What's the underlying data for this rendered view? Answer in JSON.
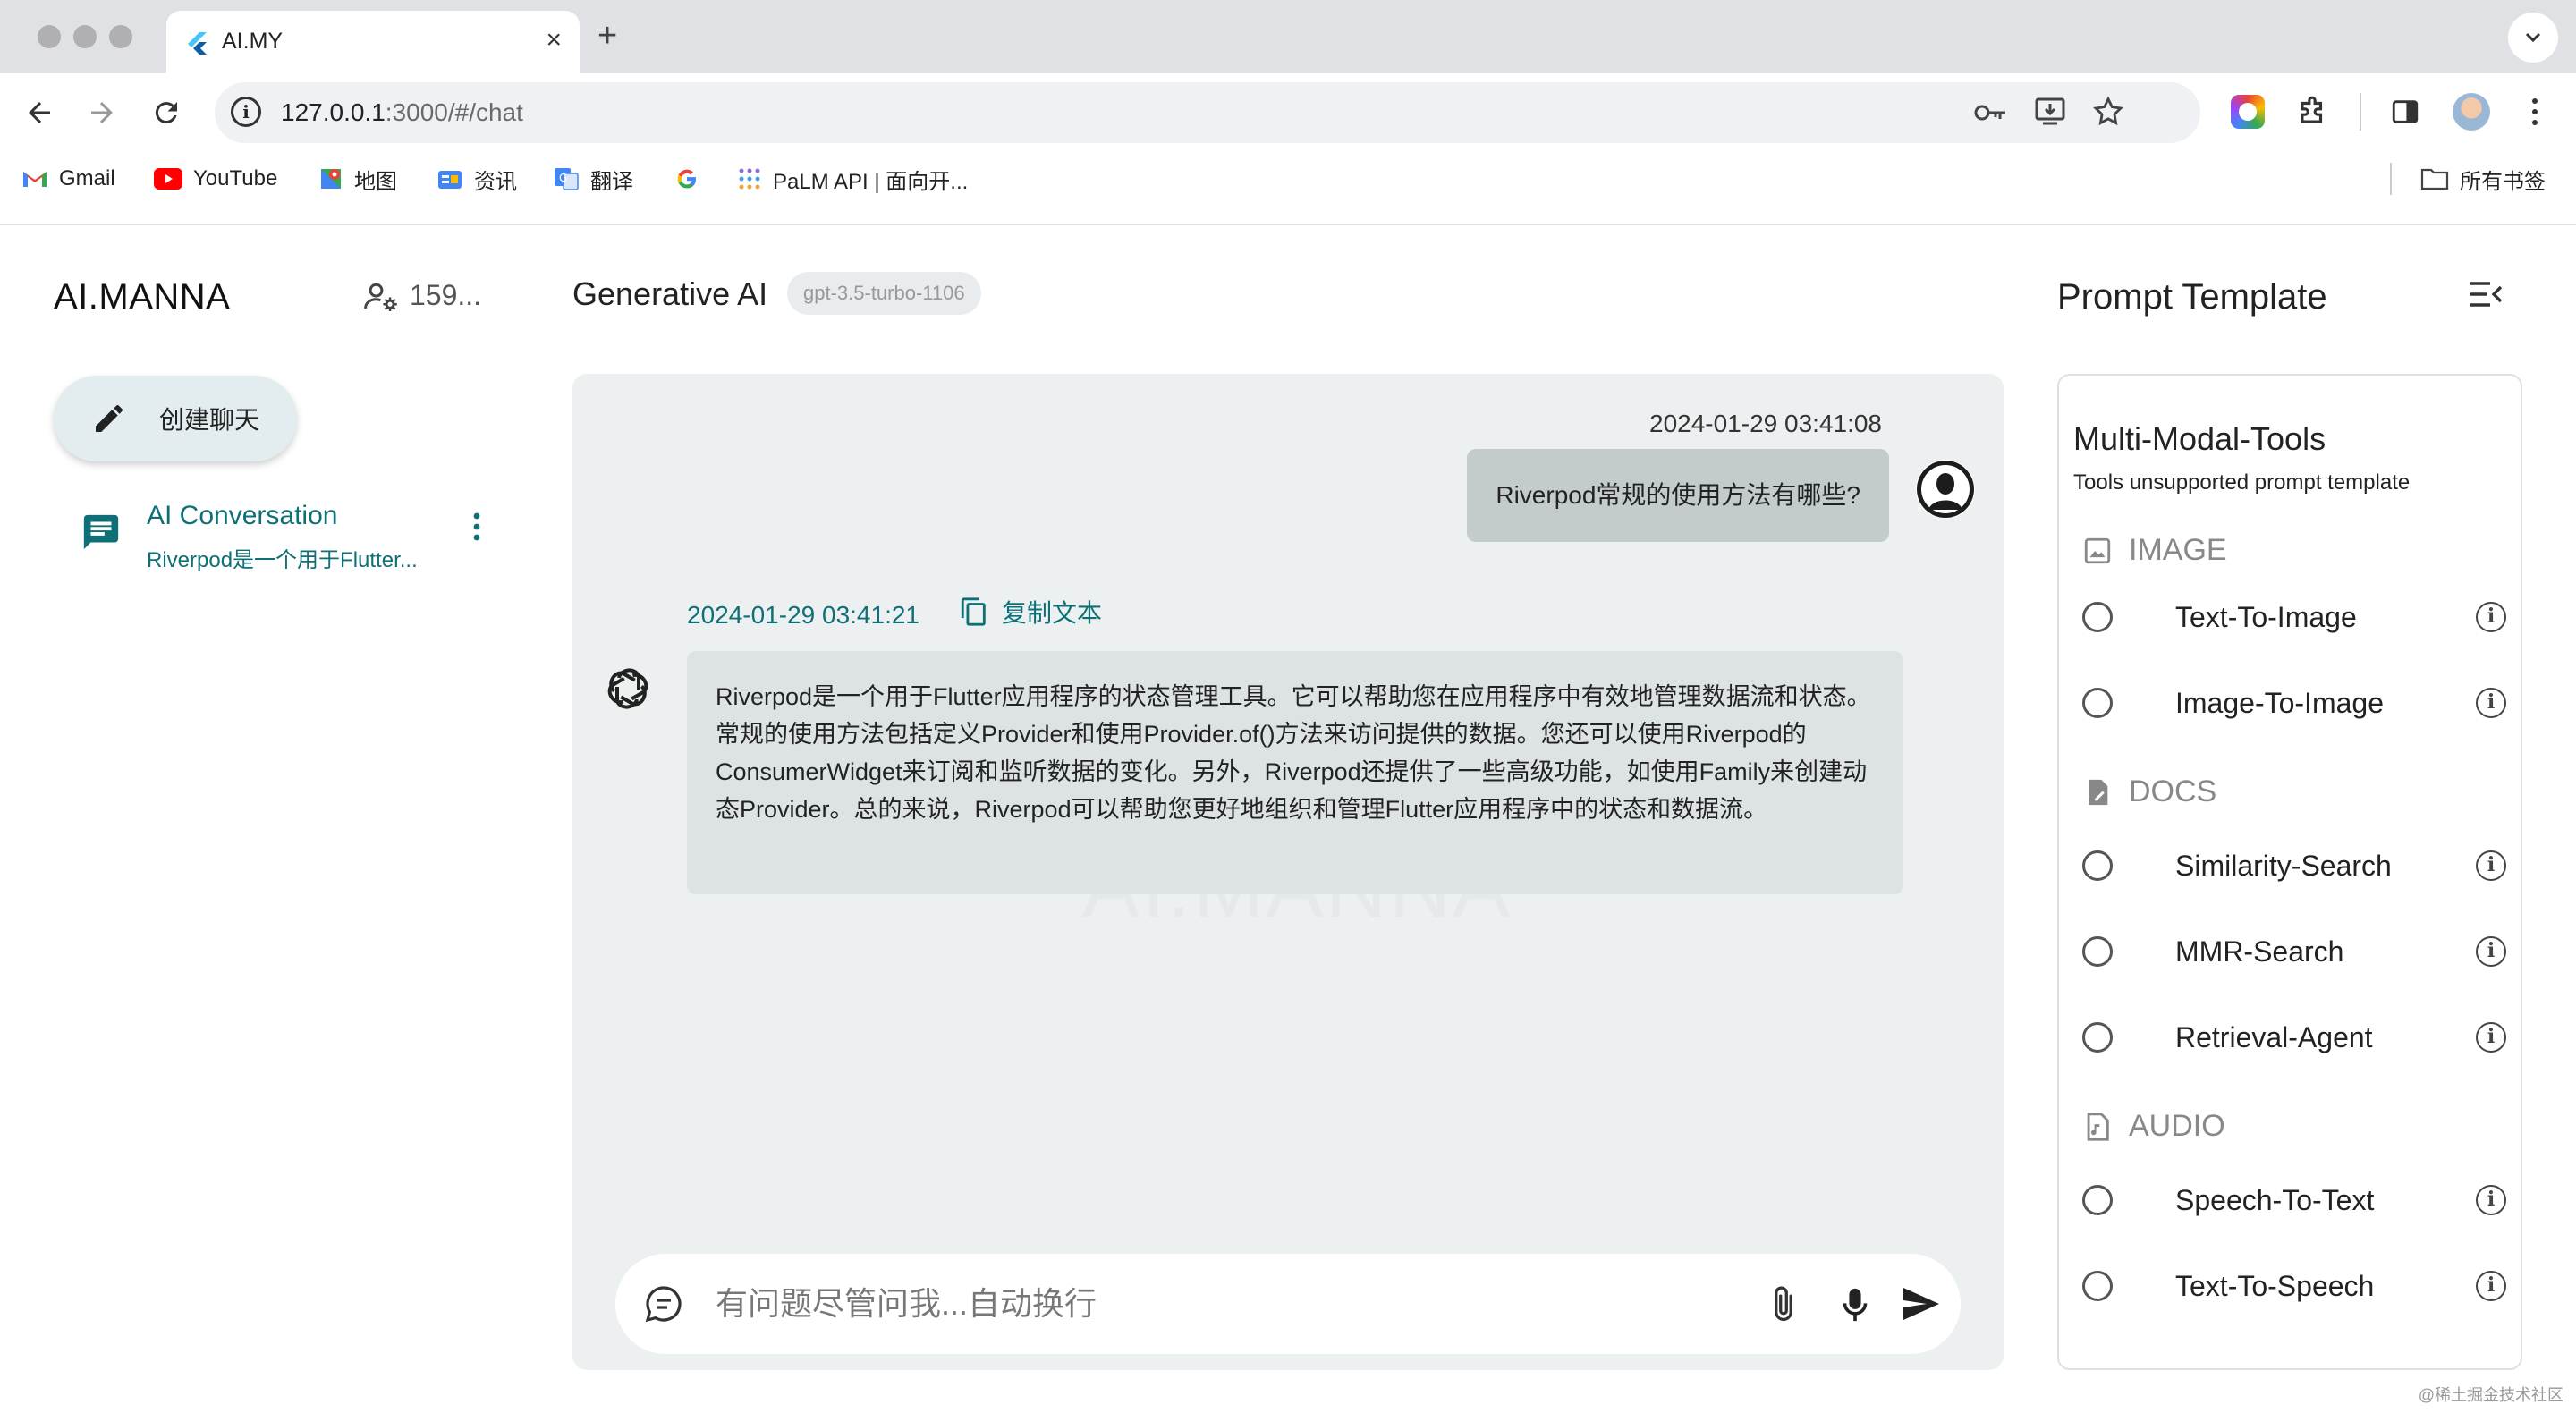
{
  "browser": {
    "tab_title": "AI.MY",
    "url_host": "127.0.0.1",
    "url_rest": ":3000/#/chat",
    "bookmarks": [
      {
        "label": "Gmail",
        "icon": "gmail-icon"
      },
      {
        "label": "YouTube",
        "icon": "youtube-icon"
      },
      {
        "label": "地图",
        "icon": "maps-icon"
      },
      {
        "label": "资讯",
        "icon": "news-icon"
      },
      {
        "label": "翻译",
        "icon": "translate-icon"
      },
      {
        "label": "",
        "icon": "google-icon"
      },
      {
        "label": "PaLM API | 面向开...",
        "icon": "palm-icon"
      }
    ],
    "all_bookmarks": "所有书签"
  },
  "sidebar": {
    "brand": "AI.MANNA",
    "user_count": "159...",
    "new_chat_label": "创建聊天",
    "conversations": [
      {
        "title": "AI Conversation",
        "subtitle": "Riverpod是一个用于Flutter..."
      }
    ]
  },
  "chat": {
    "title": "Generative AI",
    "model": "gpt-3.5-turbo-1106",
    "watermark": "AI.MANNA",
    "messages": [
      {
        "role": "user",
        "time": "2024-01-29 03:41:08",
        "text": "Riverpod常规的使用方法有哪些?"
      },
      {
        "role": "assistant",
        "time": "2024-01-29 03:41:21",
        "copy_label": "复制文本",
        "text": "Riverpod是一个用于Flutter应用程序的状态管理工具。它可以帮助您在应用程序中有效地管理数据流和状态。常规的使用方法包括定义Provider和使用Provider.of()方法来访问提供的数据。您还可以使用Riverpod的ConsumerWidget来订阅和监听数据的变化。另外，Riverpod还提供了一些高级功能，如使用Family来创建动态Provider。总的来说，Riverpod可以帮助您更好地组织和管理Flutter应用程序中的状态和数据流。"
      }
    ],
    "input_placeholder": "有问题尽管问我...自动换行"
  },
  "prompt_panel": {
    "title": "Prompt Template",
    "card_title": "Multi-Modal-Tools",
    "card_subtitle": "Tools unsupported prompt template",
    "sections": [
      {
        "label": "IMAGE",
        "icon": "image-icon",
        "options": [
          "Text-To-Image",
          "Image-To-Image"
        ]
      },
      {
        "label": "DOCS",
        "icon": "docs-icon",
        "options": [
          "Similarity-Search",
          "MMR-Search",
          "Retrieval-Agent"
        ]
      },
      {
        "label": "AUDIO",
        "icon": "audio-file-icon",
        "options": [
          "Speech-To-Text",
          "Text-To-Speech"
        ]
      }
    ]
  },
  "corner_watermark": "@稀土掘金技术社区",
  "colors": {
    "accent": "#0f6f76",
    "chat_bg": "#edf0f1",
    "user_bubble": "#c4cbcd",
    "ai_bubble": "#dde3e5"
  }
}
